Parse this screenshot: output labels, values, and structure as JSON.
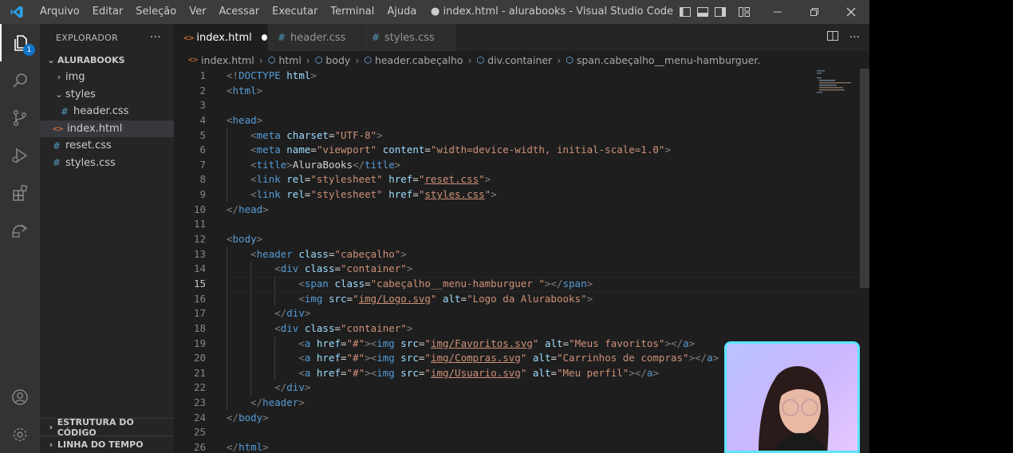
{
  "menu": [
    "Arquivo",
    "Editar",
    "Seleção",
    "Ver",
    "Acessar",
    "Executar",
    "Terminal",
    "Ajuda"
  ],
  "window_title": "● index.html - alurabooks - Visual Studio Code",
  "activity": {
    "explorer_badge": "1"
  },
  "sidebar": {
    "header": "EXPLORADOR",
    "more": "···",
    "project": "ALURABOOKS",
    "tree": [
      {
        "label": "img",
        "type": "folder",
        "expanded": false
      },
      {
        "label": "styles",
        "type": "folder",
        "expanded": true
      },
      {
        "label": "header.css",
        "type": "css"
      },
      {
        "label": "index.html",
        "type": "html",
        "selected": true
      },
      {
        "label": "reset.css",
        "type": "css"
      },
      {
        "label": "styles.css",
        "type": "css"
      }
    ],
    "outline": "ESTRUTURA DO CÓDIGO",
    "timeline": "LINHA DO TEMPO"
  },
  "tabs": [
    {
      "label": "index.html",
      "active": true,
      "modified": true
    },
    {
      "label": "header.css",
      "active": false
    },
    {
      "label": "styles.css",
      "active": false
    }
  ],
  "breadcrumb": [
    "index.html",
    "html",
    "body",
    "header.cabeçalho",
    "div.container",
    "span.cabeçalho__menu-hamburguer."
  ],
  "code": {
    "current_line": 15,
    "lines": [
      "<!DOCTYPE html>",
      "<html>",
      "",
      "<head>",
      "    <meta charset=\"UTF-8\">",
      "    <meta name=\"viewport\" content=\"width=device-width, initial-scale=1.0\">",
      "    <title>AluraBooks</title>",
      "    <link rel=\"stylesheet\" href=\"reset.css\">",
      "    <link rel=\"stylesheet\" href=\"styles.css\">",
      "</head>",
      "",
      "<body>",
      "    <header class=\"cabeçalho\">",
      "        <div class=\"container\">",
      "            <span class=\"cabeçalho__menu-hamburguer \"></span>",
      "            <img src=\"img/Logo.svg\" alt=\"Logo da Alurabooks\">",
      "        </div>",
      "        <div class=\"container\">",
      "            <a href=\"#\"><img src=\"img/Favoritos.svg\" alt=\"Meus favoritos\"></a>",
      "            <a href=\"#\"><img src=\"img/Compras.svg\" alt=\"Carrinhos de compras\"></a>",
      "            <a href=\"#\"><img src=\"img/Usuario.svg\" alt=\"Meu perfil\"></a>",
      "        </div>",
      "    </header>",
      "</body>",
      "",
      "</html>"
    ]
  },
  "colors": {
    "titlebar": "#3c3c3c",
    "activitybar": "#333333",
    "sidebar": "#252526",
    "editor": "#1e1e1e",
    "tag": "#569cd6",
    "attribute": "#9cdcfe",
    "string": "#ce9178",
    "webcam_border": "#5ce4ff"
  }
}
